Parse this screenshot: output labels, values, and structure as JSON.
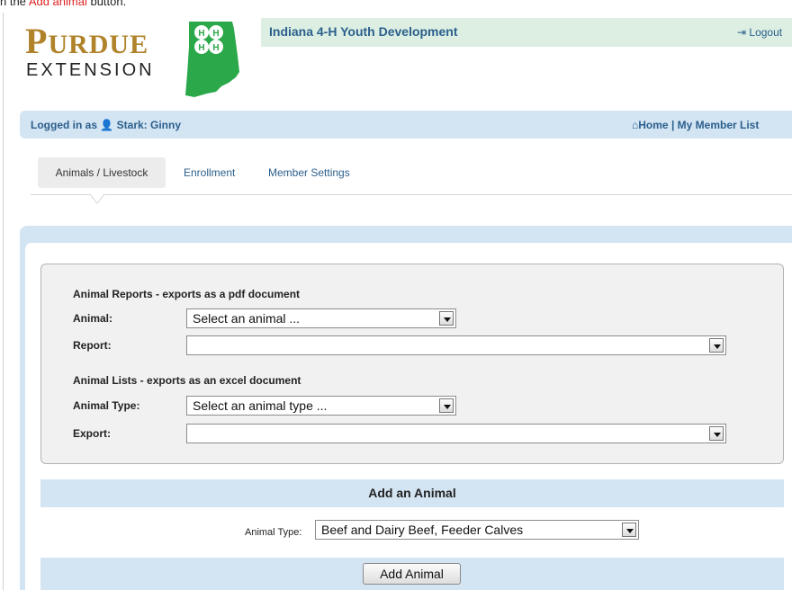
{
  "caption": {
    "prefix": "n the ",
    "highlight": "Add animal",
    "suffix": " button."
  },
  "header": {
    "org_title": "Indiana 4-H Youth Development",
    "logout_label": "Logout"
  },
  "logo": {
    "purdue_first": "P",
    "purdue_rest": "URDUE",
    "extension": "EXTENSION",
    "state_color": "#2aa84a"
  },
  "status": {
    "logged_in_prefix": "Logged in as",
    "user": "Stark: Ginny",
    "home_label": "Home",
    "separator": "|",
    "member_list_label": "My Member List"
  },
  "tabs": [
    {
      "label": "Animals / Livestock",
      "active": true
    },
    {
      "label": "Enrollment",
      "active": false
    },
    {
      "label": "Member Settings",
      "active": false
    }
  ],
  "reports": {
    "pdf_title": "Animal Reports - exports as a pdf document",
    "animal_label": "Animal:",
    "animal_value": "Select an animal ...",
    "report_label": "Report:",
    "report_value": "",
    "excel_title": "Animal Lists - exports as an excel document",
    "animal_type_label": "Animal Type:",
    "animal_type_value": "Select an animal type ...",
    "export_label": "Export:",
    "export_value": ""
  },
  "add_animal": {
    "heading": "Add an Animal",
    "type_label": "Animal Type:",
    "type_value": "Beef and Dairy Beef, Feeder Calves",
    "button_label": "Add Animal"
  },
  "colors": {
    "accent": "#2b5f8c",
    "panel": "#d3e4f3",
    "header_band": "#dcefe2",
    "caption_highlight": "#dd2222"
  }
}
